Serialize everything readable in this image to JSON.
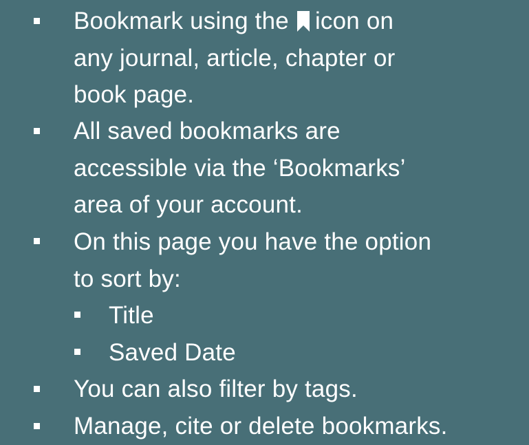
{
  "bullets": [
    {
      "lines": [
        "Bookmark using the",
        "icon on",
        "any journal, article, chapter or",
        "book page."
      ],
      "icon": "bookmark-icon"
    },
    {
      "lines": [
        "All saved bookmarks are",
        "accessible via the ‘Bookmarks’",
        "area of your account."
      ]
    },
    {
      "lines": [
        "On this page you have the option",
        "to sort by:"
      ],
      "sub_bullets": [
        "Title",
        "Saved Date"
      ]
    },
    {
      "lines": [
        "You can also filter by tags."
      ]
    },
    {
      "lines": [
        "Manage, cite or delete bookmarks."
      ]
    }
  ],
  "colors": {
    "background": "#486f77",
    "text": "#ffffff"
  }
}
